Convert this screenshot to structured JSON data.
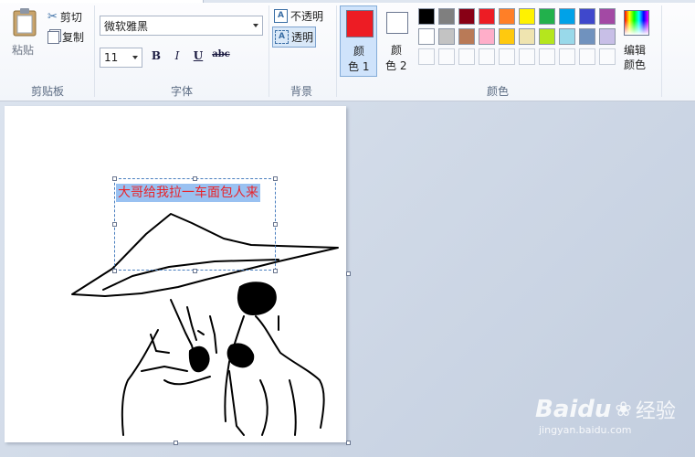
{
  "clipboard": {
    "paste_label": "粘贴",
    "cut_label": "剪切",
    "copy_label": "复制",
    "group_label": "剪贴板"
  },
  "font": {
    "family_value": "微软雅黑",
    "size_value": "11",
    "bold": "B",
    "italic": "I",
    "underline": "U",
    "strike": "abc",
    "group_label": "字体"
  },
  "background": {
    "opaque_label": "不透明",
    "transparent_label": "透明",
    "group_label": "背景"
  },
  "colors": {
    "color1_label_top": "颜",
    "color1_label_bottom": "色 1",
    "color1_value": "#ed1c24",
    "color2_label_top": "颜",
    "color2_label_bottom": "色 2",
    "color2_value": "#ffffff",
    "edit_label_top": "编辑",
    "edit_label_bottom": "颜色",
    "group_label": "颜色",
    "palette_row1": [
      "#000000",
      "#7f7f7f",
      "#880015",
      "#ed1c24",
      "#ff7f27",
      "#fff200",
      "#22b14c",
      "#00a2e8",
      "#3f48cc",
      "#a349a4"
    ],
    "palette_row2": [
      "#ffffff",
      "#c3c3c3",
      "#b97a57",
      "#ffaec9",
      "#ffc90e",
      "#efe4b0",
      "#b5e61d",
      "#99d9ea",
      "#7092be",
      "#c8bfe7"
    ]
  },
  "canvas": {
    "text_content": "大哥给我拉一车面包人来",
    "text_color": "#e8242a",
    "highlight_color": "#99c1f1"
  },
  "watermark": {
    "brand": "Baidu",
    "brand_cn": "经验",
    "url": "jingyan.baidu.com"
  }
}
